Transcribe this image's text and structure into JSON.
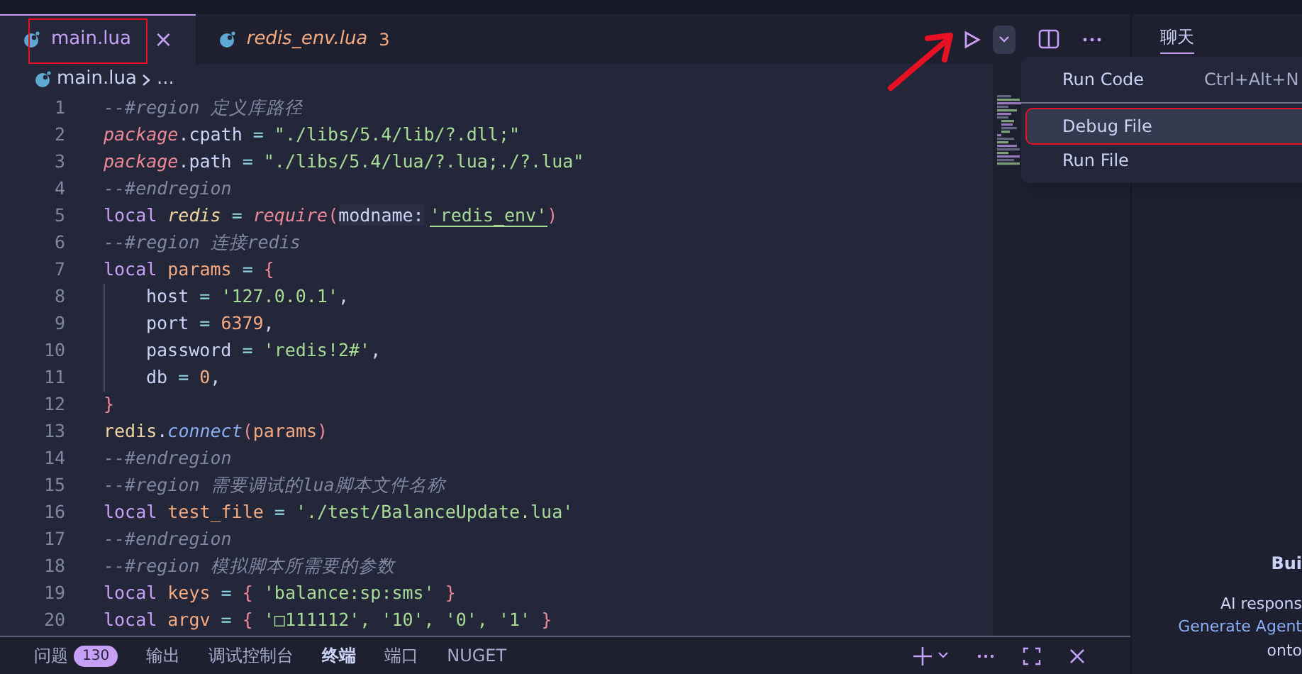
{
  "tabs": [
    {
      "label": "main.lua",
      "selected": true,
      "close": "×"
    },
    {
      "label": "redis_env.lua",
      "selected": false,
      "problems": "3"
    }
  ],
  "breadcrumb": {
    "file": "main.lua",
    "rest": "..."
  },
  "code": [
    {
      "number": "1",
      "tokens": [
        {
          "kind": "comment",
          "text": "--#region 定义库路径"
        }
      ]
    },
    {
      "number": "2",
      "tokens": [
        {
          "kind": "global",
          "text": "package"
        },
        {
          "kind": "field",
          "text": ".cpath"
        },
        {
          "kind": "op",
          "text": " = "
        },
        {
          "kind": "string",
          "text": "\"./libs/5.4/lib/?.dll;\""
        }
      ]
    },
    {
      "number": "3",
      "tokens": [
        {
          "kind": "global",
          "text": "package"
        },
        {
          "kind": "field",
          "text": ".path"
        },
        {
          "kind": "op",
          "text": " = "
        },
        {
          "kind": "string",
          "text": "\"./libs/5.4/lua/?.lua;./?.lua\""
        }
      ]
    },
    {
      "number": "4",
      "tokens": [
        {
          "kind": "comment",
          "text": "--#endregion"
        }
      ]
    },
    {
      "number": "5",
      "tokens": [
        {
          "kind": "keyword",
          "text": "local "
        },
        {
          "kind": "var",
          "text": "redis"
        },
        {
          "kind": "op",
          "text": " = "
        },
        {
          "kind": "global",
          "text": "require"
        },
        {
          "kind": "punct",
          "text": "("
        },
        {
          "kind": "hint",
          "text": "modname:"
        },
        {
          "kind": "underlined",
          "text": "'redis_env'"
        },
        {
          "kind": "punct",
          "text": ")"
        }
      ]
    },
    {
      "number": "6",
      "tokens": [
        {
          "kind": "comment",
          "text": "--#region 连接redis"
        }
      ]
    },
    {
      "number": "7",
      "tokens": [
        {
          "kind": "keyword",
          "text": "local "
        },
        {
          "kind": "name",
          "text": "params"
        },
        {
          "kind": "op",
          "text": " = "
        },
        {
          "kind": "punct",
          "text": "{"
        }
      ]
    },
    {
      "number": "8",
      "indent": true,
      "tokens": [
        {
          "kind": "plain",
          "text": "host"
        },
        {
          "kind": "op",
          "text": " = "
        },
        {
          "kind": "string",
          "text": "'127.0.0.1'"
        },
        {
          "kind": "plain",
          "text": ","
        }
      ]
    },
    {
      "number": "9",
      "indent": true,
      "tokens": [
        {
          "kind": "plain",
          "text": "port"
        },
        {
          "kind": "op",
          "text": " = "
        },
        {
          "kind": "number",
          "text": "6379"
        },
        {
          "kind": "plain",
          "text": ","
        }
      ]
    },
    {
      "number": "10",
      "indent": true,
      "tokens": [
        {
          "kind": "plain",
          "text": "password"
        },
        {
          "kind": "op",
          "text": " = "
        },
        {
          "kind": "string",
          "text": "'redis!2#'"
        },
        {
          "kind": "plain",
          "text": ","
        }
      ]
    },
    {
      "number": "11",
      "indent": true,
      "tokens": [
        {
          "kind": "plain",
          "text": "db"
        },
        {
          "kind": "op",
          "text": " = "
        },
        {
          "kind": "number",
          "text": "0"
        },
        {
          "kind": "plain",
          "text": ","
        }
      ]
    },
    {
      "number": "12",
      "tokens": [
        {
          "kind": "punct",
          "text": "}"
        }
      ]
    },
    {
      "number": "13",
      "tokens": [
        {
          "kind": "module",
          "text": "redis"
        },
        {
          "kind": "plain",
          "text": "."
        },
        {
          "kind": "func",
          "text": "connect"
        },
        {
          "kind": "punct",
          "text": "("
        },
        {
          "kind": "name",
          "text": "params"
        },
        {
          "kind": "punct",
          "text": ")"
        }
      ]
    },
    {
      "number": "14",
      "tokens": [
        {
          "kind": "comment",
          "text": "--#endregion"
        }
      ]
    },
    {
      "number": "15",
      "tokens": [
        {
          "kind": "comment",
          "text": "--#region 需要调试的lua脚本文件名称"
        }
      ]
    },
    {
      "number": "16",
      "tokens": [
        {
          "kind": "keyword",
          "text": "local "
        },
        {
          "kind": "name",
          "text": "test_file"
        },
        {
          "kind": "op",
          "text": " = "
        },
        {
          "kind": "string",
          "text": "'./test/BalanceUpdate.lua'"
        }
      ]
    },
    {
      "number": "17",
      "tokens": [
        {
          "kind": "comment",
          "text": "--#endregion"
        }
      ]
    },
    {
      "number": "18",
      "tokens": [
        {
          "kind": "comment",
          "text": "--#region 模拟脚本所需要的参数"
        }
      ]
    },
    {
      "number": "19",
      "tokens": [
        {
          "kind": "keyword",
          "text": "local "
        },
        {
          "kind": "name",
          "text": "keys"
        },
        {
          "kind": "op",
          "text": " = "
        },
        {
          "kind": "punct",
          "text": "{ "
        },
        {
          "kind": "string",
          "text": "'balance:sp:sms'"
        },
        {
          "kind": "punct",
          "text": " }"
        }
      ]
    },
    {
      "number": "20",
      "tokens": [
        {
          "kind": "keyword",
          "text": "local "
        },
        {
          "kind": "name",
          "text": "argv"
        },
        {
          "kind": "op",
          "text": " = "
        },
        {
          "kind": "punct",
          "text": "{ "
        },
        {
          "kind": "string",
          "text": "'□111112', '10', '0', '1'"
        },
        {
          "kind": "punct",
          "text": " }"
        }
      ]
    }
  ],
  "run_menu": [
    {
      "kind": "item",
      "label": "Run Code",
      "shortcut": "Ctrl+Alt+N",
      "selected": false
    },
    {
      "kind": "separator"
    },
    {
      "kind": "item",
      "label": "Debug File",
      "selected": true
    },
    {
      "kind": "item",
      "label": "Run File",
      "selected": false
    }
  ],
  "chat": {
    "tab": "聊天",
    "title": "Bui",
    "text": "AI respons",
    "link": "Generate Agent",
    "text2": "onto"
  },
  "panel_tabs": [
    {
      "label": "问题",
      "badge": "130",
      "selected": false
    },
    {
      "label": "输出",
      "selected": false
    },
    {
      "label": "调试控制台",
      "selected": false
    },
    {
      "label": "终端",
      "selected": true
    },
    {
      "label": "端口",
      "selected": false
    },
    {
      "label": "NUGET",
      "selected": false
    }
  ]
}
